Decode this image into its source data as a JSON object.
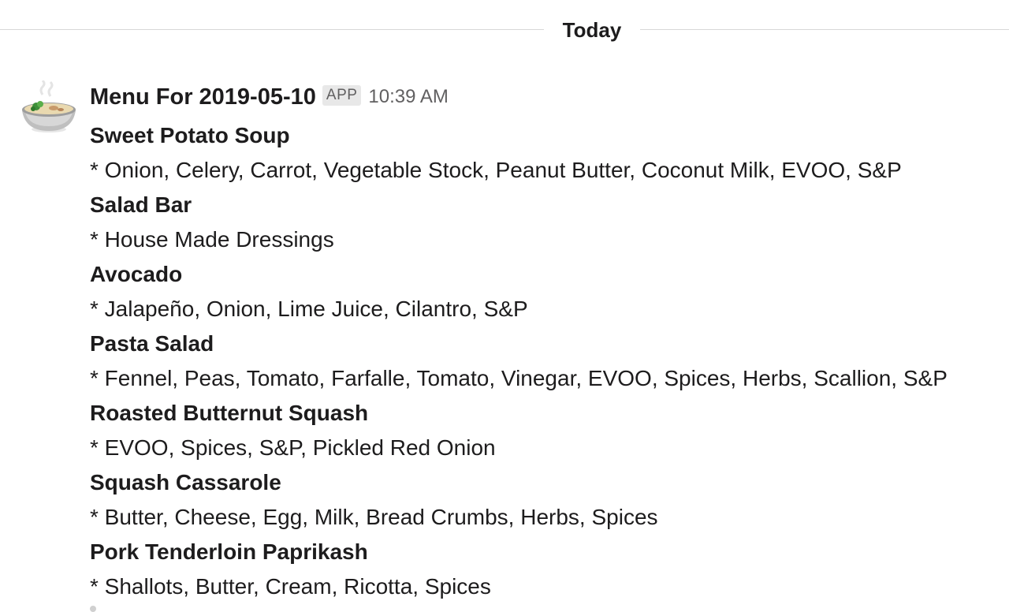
{
  "divider": {
    "label": "Today"
  },
  "message": {
    "sender": "Menu For 2019-05-10",
    "badge": "APP",
    "time": "10:39 AM",
    "avatar_icon": "soup-bowl-icon",
    "items": [
      {
        "dish": "Sweet Potato Soup",
        "ingredients": "* Onion, Celery, Carrot, Vegetable Stock, Peanut Butter, Coconut Milk, EVOO, S&P"
      },
      {
        "dish": "Salad Bar",
        "ingredients": "* House Made Dressings"
      },
      {
        "dish": "Avocado",
        "ingredients": "* Jalapeño, Onion, Lime Juice, Cilantro, S&P"
      },
      {
        "dish": "Pasta Salad",
        "ingredients": "* Fennel, Peas, Tomato, Farfalle, Tomato, Vinegar, EVOO, Spices, Herbs, Scallion, S&P"
      },
      {
        "dish": "Roasted Butternut Squash",
        "ingredients": "* EVOO, Spices, S&P, Pickled Red Onion"
      },
      {
        "dish": "Squash Cassarole",
        "ingredients": "* Butter, Cheese, Egg, Milk, Bread Crumbs, Herbs, Spices"
      },
      {
        "dish": "Pork Tenderloin Paprikash",
        "ingredients": "* Shallots, Butter, Cream, Ricotta, Spices"
      }
    ]
  }
}
